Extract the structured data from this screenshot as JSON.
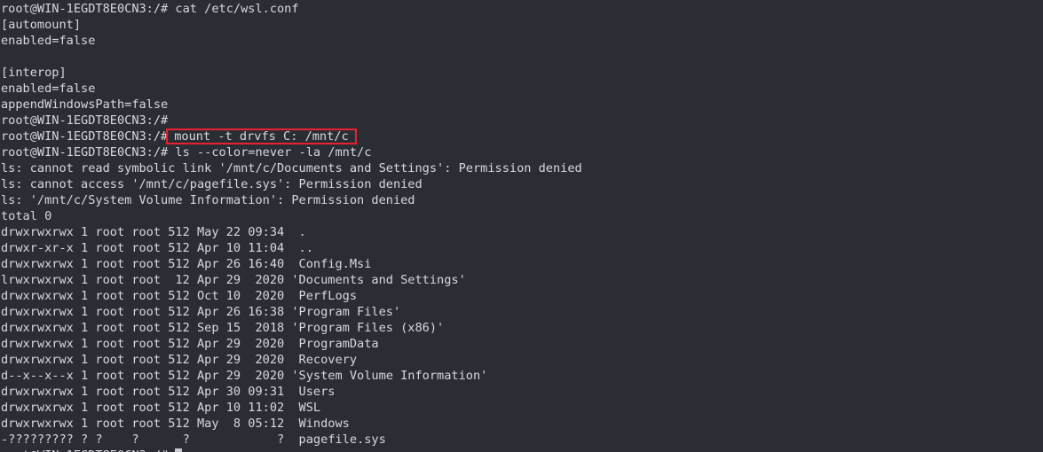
{
  "terminal": {
    "prompt": "root@WIN-1EGDT8E0CN3:/#",
    "lines": [
      "root@WIN-1EGDT8E0CN3:/# cat /etc/wsl.conf",
      "[automount]",
      "enabled=false",
      "",
      "[interop]",
      "enabled=false",
      "appendWindowsPath=false",
      "root@WIN-1EGDT8E0CN3:/#"
    ],
    "mount_command": "mount -t drvfs C: /mnt/c",
    "listing": [
      "root@WIN-1EGDT8E0CN3:/# ls --color=never -la /mnt/c",
      "ls: cannot read symbolic link '/mnt/c/Documents and Settings': Permission denied",
      "ls: cannot access '/mnt/c/pagefile.sys': Permission denied",
      "ls: '/mnt/c/System Volume Information': Permission denied",
      "total 0",
      "drwxrwxrwx 1 root root 512 May 22 09:34  .",
      "drwxr-xr-x 1 root root 512 Apr 10 11:04  ..",
      "drwxrwxrwx 1 root root 512 Apr 26 16:40  Config.Msi",
      "lrwxrwxrwx 1 root root  12 Apr 29  2020 'Documents and Settings'",
      "drwxrwxrwx 1 root root 512 Oct 10  2020  PerfLogs",
      "drwxrwxrwx 1 root root 512 Apr 26 16:38 'Program Files'",
      "drwxrwxrwx 1 root root 512 Sep 15  2018 'Program Files (x86)'",
      "drwxrwxrwx 1 root root 512 Apr 29  2020  ProgramData",
      "drwxrwxrwx 1 root root 512 Apr 29  2020  Recovery",
      "d--x--x--x 1 root root 512 Apr 29  2020 'System Volume Information'",
      "drwxrwxrwx 1 root root 512 Apr 30 09:31  Users",
      "drwxrwxrwx 1 root root 512 Apr 10 11:02  WSL",
      "drwxrwxrwx 1 root root 512 May  8 05:12  Windows",
      "-????????? ? ?    ?      ?            ?  pagefile.sys"
    ]
  },
  "colors": {
    "background": "#2b2d35",
    "text": "#d7d9de",
    "highlight_box": "#e8232f"
  }
}
